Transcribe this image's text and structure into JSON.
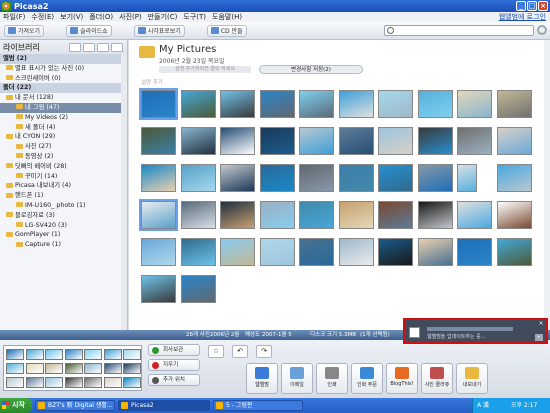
{
  "window": {
    "title": "Picasa2",
    "login": "웹앨범에 로그인",
    "close": "×",
    "min": "_",
    "max": "□"
  },
  "menu": [
    "파일(F)",
    "수정(E)",
    "보기(V)",
    "폴더(O)",
    "사진(P)",
    "만들기(C)",
    "도구(T)",
    "도움말(H)"
  ],
  "toolbar": {
    "import": "가져오기",
    "slideshow": "슬라이드쇼",
    "timeline": "시각표로보기",
    "cd": "CD 만들"
  },
  "sidebar": {
    "title": "라이브러리",
    "rows": [
      {
        "t": "앨범 (2)",
        "k": "sec"
      },
      {
        "t": "별표 표시가 있는 사진 (0)",
        "k": "i1"
      },
      {
        "t": "스크린세이버 (0)",
        "k": "i1"
      },
      {
        "t": "폴더 (22)",
        "k": "sec"
      },
      {
        "t": "내 문서 (128)",
        "k": "i1"
      },
      {
        "t": "내 그림 (47)",
        "k": "sel"
      },
      {
        "t": "My Videos (2)",
        "k": "i2"
      },
      {
        "t": "새 폴더 (4)",
        "k": "i2"
      },
      {
        "t": "내 CYON (29)",
        "k": "i1"
      },
      {
        "t": "사진 (27)",
        "k": "i2"
      },
      {
        "t": "동영상 (2)",
        "k": "i2"
      },
      {
        "t": "딧빠의 베이비 (28)",
        "k": "i1"
      },
      {
        "t": "꾸미기 (14)",
        "k": "i2"
      },
      {
        "t": "Picasa 내보내기 (4)",
        "k": "i1"
      },
      {
        "t": "핸드폰 (1)",
        "k": "i1"
      },
      {
        "t": "IM-U160_ photo (1)",
        "k": "i2"
      },
      {
        "t": "블로깅자료 (3)",
        "k": "i1"
      },
      {
        "t": "LG-SV420 (3)",
        "k": "i2"
      },
      {
        "t": "GomPlayer (1)",
        "k": "i1"
      },
      {
        "t": "Capture (1)",
        "k": "i2"
      }
    ]
  },
  "folder": {
    "name": "My Pictures",
    "date": "2006년 2월 23일 목요일",
    "desc": "설명 추가하려면 클릭 하세요",
    "pill": "변경사항 저장(2)",
    "caption": "설명 추가"
  },
  "status": {
    "count": "28개 사진",
    "date": "2006년 2월",
    "res": "해상도",
    "date2": "2007-1월 5",
    "size": "디스크 크기 5.3MB",
    "sel": "(1개 선택됨)"
  },
  "traybuttons": [
    {
      "label": "회사보관",
      "color": "#2a9a2a"
    },
    {
      "label": "지우기",
      "color": "#d02020"
    },
    {
      "label": "추가 위치",
      "color": "#555"
    }
  ],
  "actions": [
    "웹앨범",
    "이메일",
    "인쇄",
    "인화 주문",
    "BlogThis!",
    "사진 콜라쥬",
    "내보내기"
  ],
  "popup": {
    "text": "웹앨범을 업데이트하는 중..."
  },
  "taskbar": {
    "start": "시작",
    "tasks": [
      "BZT's 新 Digital 생활...",
      "Picasa2",
      "5 - 그림판"
    ],
    "lang": "A 漢",
    "clock": "오후 2:17"
  },
  "thumb_colors": [
    "#1e6fb8",
    "#45a8d8",
    "#6ec2e8",
    "#2b85c8",
    "#7fd0ee",
    "#3d9fd8",
    "#a4d8ec",
    "#56b0dc",
    "#e2d8b8",
    "#c2b894",
    "#4c5a38",
    "#8ab4ce",
    "#274e76",
    "#1b3a5a",
    "#b8c8d0",
    "#5e7c98",
    "#9cc4dc",
    "#3a3a3a",
    "#707070",
    "#d8d0c8",
    "#1a88c8",
    "#58a0c8",
    "#c4c8cc",
    "#2a6a9a",
    "#606870",
    "#3c7ea8",
    "#2890d0",
    "#8898a8",
    "#d8e0e8",
    "#4aa8e0",
    "#e8ecf0",
    "#5a6a7a",
    "#203040",
    "#9ab0c0",
    "#4488aa",
    "#c8a070",
    "#784830",
    "#181818",
    "#e0e0e0",
    "#ffffff",
    "#6aa8d8",
    "#2f6a8e",
    "#88ccf0",
    "#b0d8ec",
    "#487090",
    "#a0b8c8",
    "#1c5c8c",
    "#e8d0b0"
  ]
}
